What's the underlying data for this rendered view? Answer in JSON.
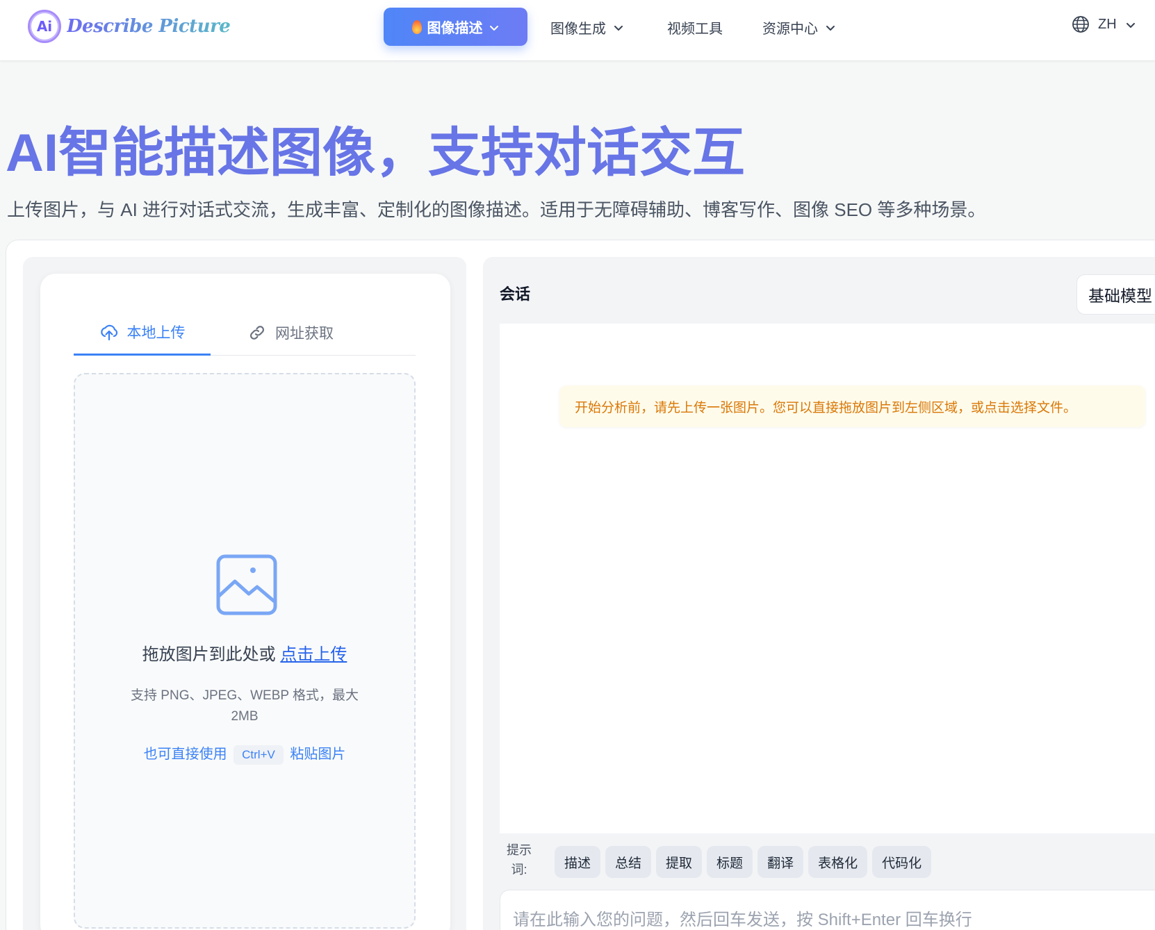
{
  "header": {
    "logo_badge": "Ai",
    "logo_text": "Describe Picture",
    "nav": {
      "primary": "图像描述",
      "generate": "图像生成",
      "video": "视频工具",
      "resources": "资源中心"
    },
    "lang": "ZH"
  },
  "hero": {
    "title": "AI智能描述图像，支持对话交互",
    "subtitle": "上传图片，与 AI 进行对话式交流，生成丰富、定制化的图像描述。适用于无障碍辅助、博客写作、图像 SEO 等多种场景。"
  },
  "upload": {
    "tabs": {
      "local": "本地上传",
      "url": "网址获取"
    },
    "drop_text": "拖放图片到此处或",
    "drop_link": "点击上传",
    "hint": "支持 PNG、JPEG、WEBP 格式，最大 2MB",
    "paste_before": "也可直接使用",
    "paste_key": "Ctrl+V",
    "paste_after": "粘贴图片"
  },
  "chat": {
    "title": "会话",
    "model": "基础模型",
    "notice": "开始分析前，请先上传一张图片。您可以直接拖放图片到左侧区域，或点击选择文件。",
    "prompt_label": "提示词:",
    "chips": [
      "描述",
      "总结",
      "提取",
      "标题",
      "翻译",
      "表格化",
      "代码化"
    ],
    "input_placeholder": "请在此输入您的问题，然后回车发送，按 Shift+Enter 回车换行"
  },
  "colors": {
    "accent": "#3b82f6",
    "hero_title": "#6775e6",
    "notice_text": "#d97706",
    "notice_bg": "#fffbeb"
  },
  "icons": [
    "globe-icon",
    "chevron-down-icon",
    "flame-icon",
    "upload-cloud-icon",
    "link-icon",
    "image-icon"
  ]
}
